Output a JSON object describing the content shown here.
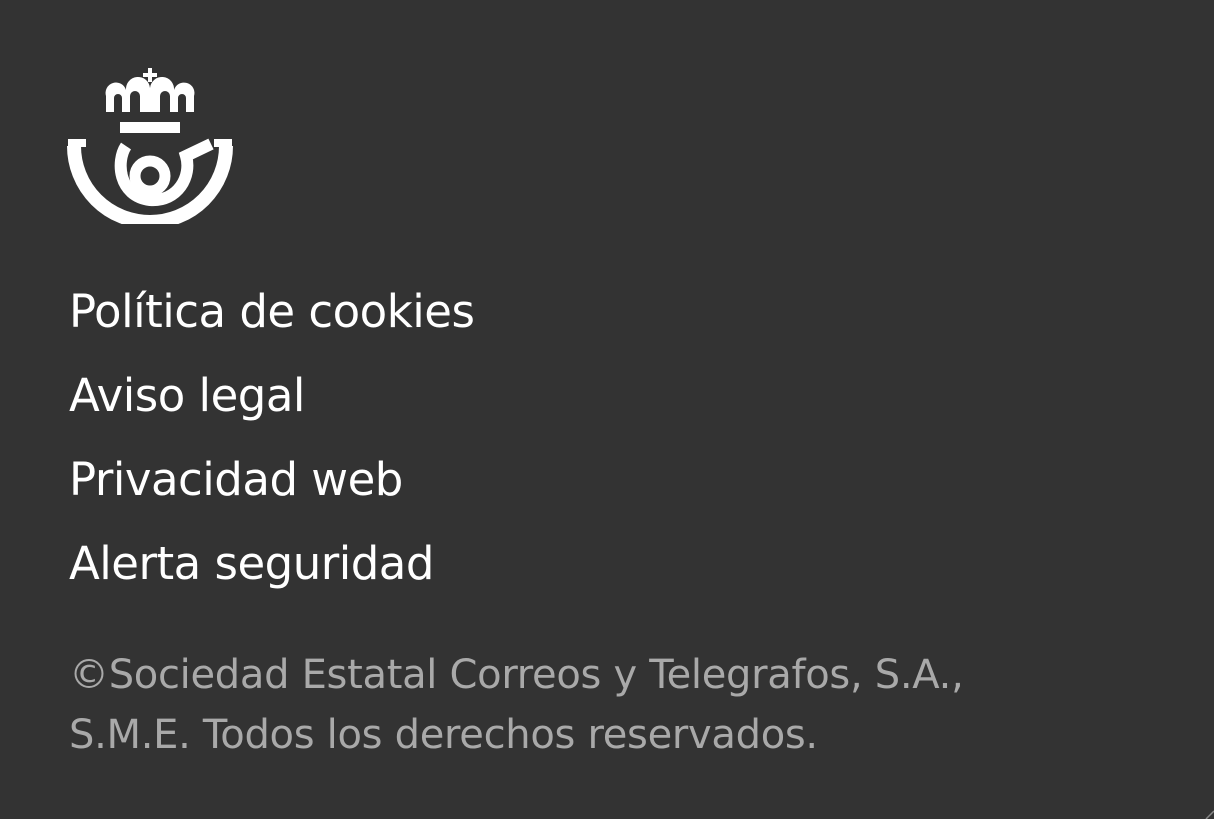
{
  "logo": {
    "name": "correos-logo",
    "color": "#ffffff"
  },
  "footer": {
    "links": [
      {
        "label": "Política de cookies"
      },
      {
        "label": "Aviso legal"
      },
      {
        "label": "Privacidad web"
      },
      {
        "label": "Alerta seguridad"
      }
    ],
    "copyright_line1": "©Sociedad Estatal Correos y Telegrafos, S.A.,",
    "copyright_line2": "S.M.E. Todos los derechos reservados."
  },
  "colors": {
    "background": "#333333",
    "link": "#ffffff",
    "copyright": "#a9a9a9"
  }
}
